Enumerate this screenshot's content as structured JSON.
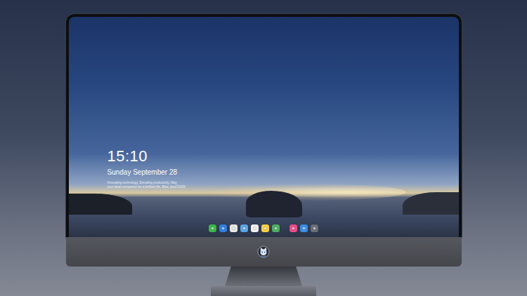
{
  "lock_screen": {
    "time": "15:10",
    "date": "Sunday September 28",
    "tagline": [
      "Innovating technology, Elevating productivity. May",
      "your ideal companion for a brilliant life. Bliss Joss©2025"
    ]
  },
  "dock": {
    "groups": [
      [
        {
          "color": "#3cb54a"
        },
        {
          "color": "#2f7fe0"
        },
        {
          "color": "#e6e6e6"
        },
        {
          "color": "#5aa6e8"
        },
        {
          "color": "#f2f2f2"
        },
        {
          "color": "#f5d04a"
        },
        {
          "color": "#4faf63"
        }
      ],
      [
        {
          "color": "#e84d8a"
        },
        {
          "color": "#3a8ee6"
        },
        {
          "color": "#6a6f78"
        }
      ]
    ]
  }
}
